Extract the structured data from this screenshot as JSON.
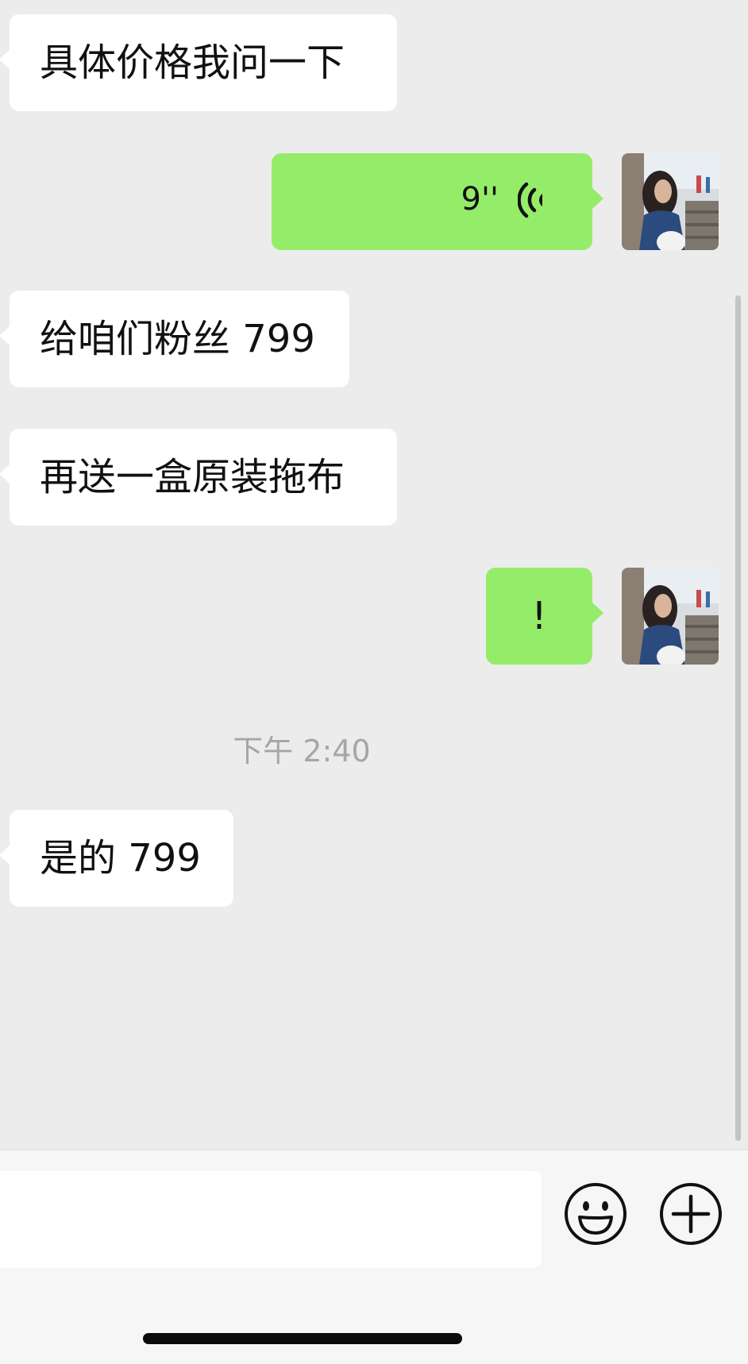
{
  "chat": {
    "messages": [
      {
        "side": "received",
        "type": "text",
        "text": "具体价格我问一下"
      },
      {
        "side": "sent",
        "type": "voice",
        "duration": "9''"
      },
      {
        "side": "received",
        "type": "text",
        "text": "给咱们粉丝 799"
      },
      {
        "side": "received",
        "type": "text",
        "text": "再送一盒原装拖布"
      },
      {
        "side": "sent",
        "type": "text",
        "text": "!"
      },
      {
        "side": "received",
        "type": "text",
        "text": "是的 799"
      }
    ],
    "timestamp": "下午 2:40"
  },
  "input_bar": {
    "input_value": "",
    "icons": [
      "emoji-icon",
      "plus-icon"
    ]
  },
  "colors": {
    "background": "#ececec",
    "received_bubble": "#ffffff",
    "sent_bubble": "#95ec69",
    "timestamp": "#a6a6a6"
  }
}
